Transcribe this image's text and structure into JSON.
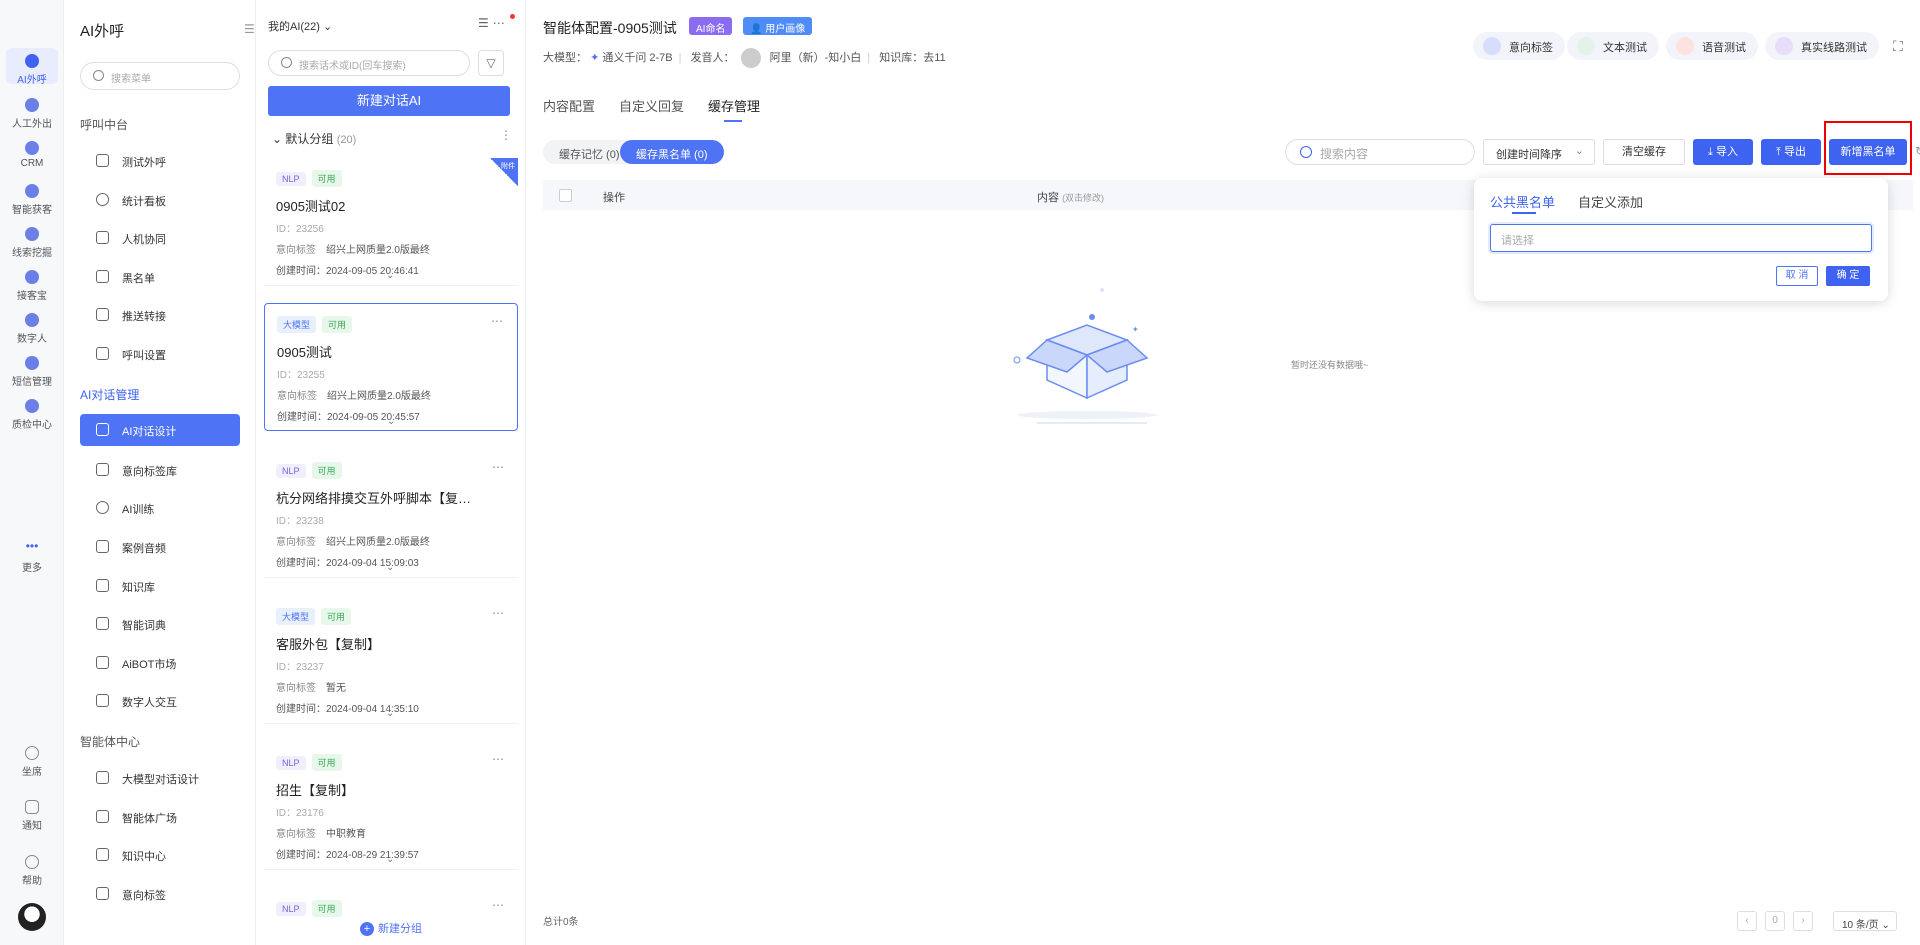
{
  "rail": {
    "items": [
      {
        "label": "AI外呼",
        "icon": "phone-robot-icon",
        "active": true
      },
      {
        "label": "人工外出",
        "icon": "headset-icon"
      },
      {
        "label": "CRM",
        "icon": "crm-icon"
      },
      {
        "label": "智能获客",
        "icon": "target-icon"
      },
      {
        "label": "线索挖掘",
        "icon": "dig-icon"
      },
      {
        "label": "接客宝",
        "icon": "reception-icon"
      },
      {
        "label": "数字人",
        "icon": "digital-human-icon"
      },
      {
        "label": "短信管理",
        "icon": "sms-icon"
      },
      {
        "label": "质检中心",
        "icon": "qc-icon"
      },
      {
        "label": "更多",
        "icon": "more-dots-icon"
      }
    ],
    "bottom": [
      {
        "label": "坐席",
        "icon": "seat-icon"
      },
      {
        "label": "通知",
        "icon": "bell-icon"
      },
      {
        "label": "帮助",
        "icon": "help-icon"
      }
    ]
  },
  "menu": {
    "title": "AI外呼",
    "search_placeholder": "搜索菜单",
    "sections": [
      {
        "title": "呼叫中台",
        "items": [
          "测试外呼",
          "统计看板",
          "人机协同",
          "黑名单",
          "推送转接",
          "呼叫设置"
        ]
      },
      {
        "title": "AI对话管理",
        "items": [
          "AI对话设计",
          "意向标签库",
          "AI训练",
          "案例音频",
          "知识库",
          "智能词典",
          "AiBOT市场",
          "数字人交互"
        ]
      },
      {
        "title": "智能体中心",
        "items": [
          "大模型对话设计",
          "智能体广场",
          "知识中心",
          "意向标签"
        ]
      }
    ],
    "active_item": "AI对话设计"
  },
  "list": {
    "header": "我的AI(22)",
    "search_placeholder": "搜索话术或ID(回车搜索)",
    "new_button": "新建对话AI",
    "group_name": "默认分组",
    "group_count": "(20)",
    "add_group": "新建分组",
    "cards": [
      {
        "type": "NLP",
        "status": "可用",
        "title": "0905测试02",
        "id": "ID：23256",
        "intent_label": "意向标签",
        "intent_value": "绍兴上网质量2.0版最终",
        "created": "创建时间：2024-09-05 20:46:41",
        "ribbon": "附件"
      },
      {
        "type": "大模型",
        "status": "可用",
        "title": "0905测试",
        "id": "ID：23255",
        "intent_label": "意向标签",
        "intent_value": "绍兴上网质量2.0版最终",
        "created": "创建时间：2024-09-05 20:45:57",
        "selected": true
      },
      {
        "type": "NLP",
        "status": "可用",
        "title": "杭分网络排摸交互外呼脚本【复制】",
        "id": "ID：23238",
        "intent_label": "意向标签",
        "intent_value": "绍兴上网质量2.0版最终",
        "created": "创建时间：2024-09-04 15:09:03"
      },
      {
        "type": "大模型",
        "status": "可用",
        "title": "客服外包【复制】",
        "id": "ID：23237",
        "intent_label": "意向标签",
        "intent_value": "暂无",
        "created": "创建时间：2024-09-04 14:35:10"
      },
      {
        "type": "NLP",
        "status": "可用",
        "title": "招生【复制】",
        "id": "ID：23176",
        "intent_label": "意向标签",
        "intent_value": "中职教育",
        "created": "创建时间：2024-08-29 21:39:57"
      },
      {
        "type": "NLP",
        "status": "可用",
        "title": "",
        "id": "",
        "intent_label": "",
        "intent_value": "",
        "created": ""
      }
    ]
  },
  "main": {
    "title": "智能体配置-0905测试",
    "badge_ai": "AI命名",
    "badge_user": "用户画像",
    "meta": {
      "model_label": "大模型：",
      "model_value": "通义千问 2-7B",
      "speaker_label": "发音人：",
      "speaker_value": "阿里（新）-知小白",
      "kb": "知识库：去11"
    },
    "top_buttons": [
      "意向标签",
      "文本测试",
      "语音测试",
      "真实线路测试"
    ],
    "tabs": [
      "内容配置",
      "自定义回复",
      "缓存管理"
    ],
    "active_tab": "缓存管理",
    "pills": {
      "memory": "缓存记忆 (0)",
      "blacklist": "缓存黑名单 (0)"
    },
    "search_placeholder": "搜索内容",
    "sort": "创建时间降序",
    "clear": "清空缓存",
    "import": "导入",
    "export": "导出",
    "add_blacklist": "新增黑名单",
    "table": {
      "col_action": "操作",
      "col_content": "内容",
      "col_content_hint": "(双击修改)"
    },
    "empty_text": "暂时还没有数据哦~",
    "total": "总计0条",
    "page": "0",
    "page_size": "10 条/页"
  },
  "popover": {
    "tab1": "公共黑名单",
    "tab2": "自定义添加",
    "placeholder": "请选择",
    "cancel": "取 消",
    "ok": "确 定"
  }
}
